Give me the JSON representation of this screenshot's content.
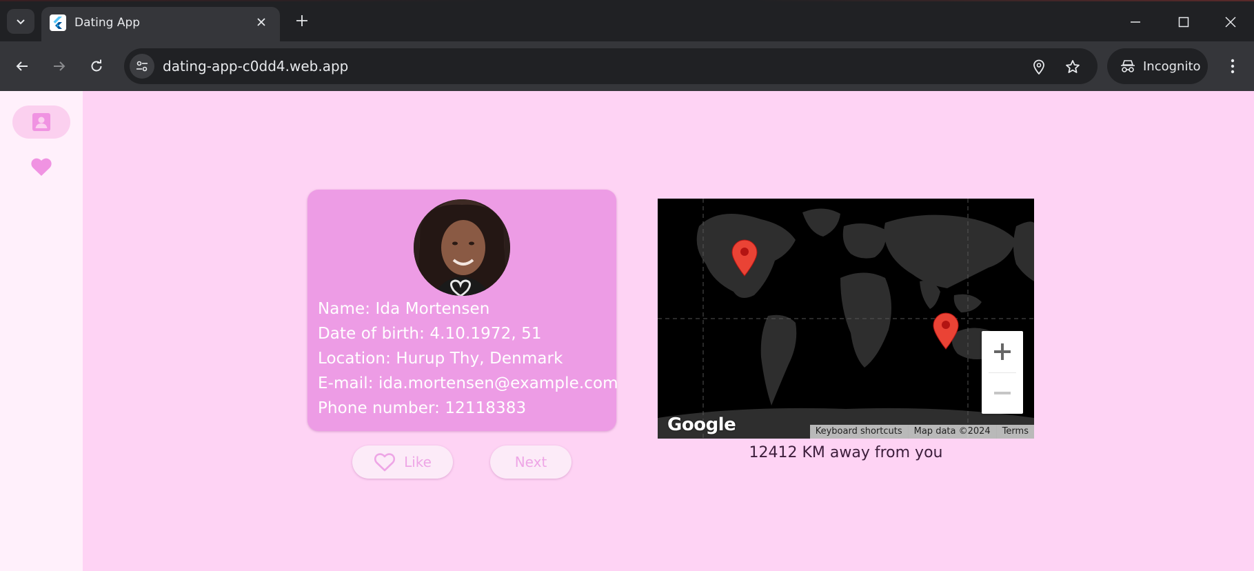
{
  "browser": {
    "tab_title": "Dating App",
    "url": "dating-app-c0dd4.web.app",
    "incognito_label": "Incognito"
  },
  "nav_rail": {
    "items": [
      {
        "icon": "profile-icon",
        "selected": true
      },
      {
        "icon": "heart-icon",
        "selected": false
      }
    ]
  },
  "profile": {
    "name_line": "Name: Ida Mortensen",
    "dob_line": "Date of birth: 4.10.1972, 51",
    "location_line": "Location: Hurup Thy, Denmark",
    "email_line": "E-mail: ida.mortensen@example.com",
    "phone_line": "Phone number: 12118383"
  },
  "actions": {
    "like_label": "Like",
    "next_label": "Next"
  },
  "map": {
    "logo": "Google",
    "keyboard_shortcuts": "Keyboard shortcuts",
    "map_data": "Map data ©2024",
    "terms": "Terms",
    "distance_text": "12412 KM away from you"
  },
  "colors": {
    "page_bg": "#fed3f4",
    "card_bg": "#ed9ce5",
    "accent": "#eea6e6",
    "marker": "#ea4335"
  }
}
